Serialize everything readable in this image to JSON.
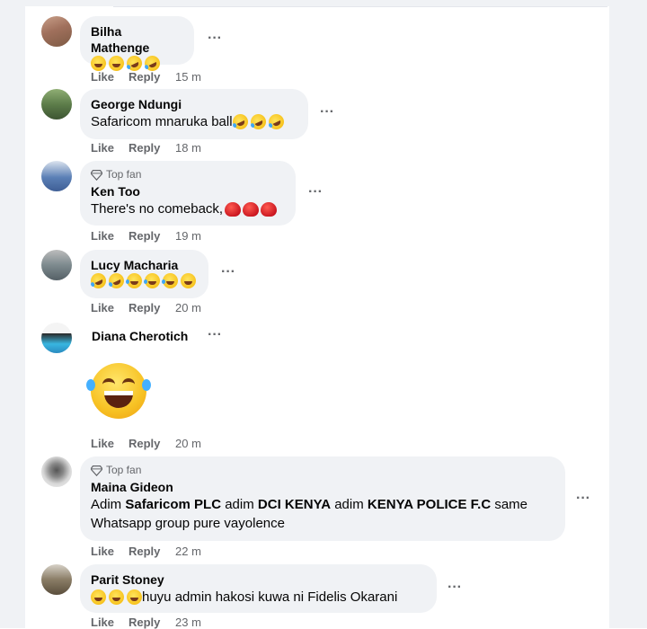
{
  "comments": [
    {
      "author": "Bilha Mathenge",
      "text": "",
      "emojis": 4,
      "top_fan": "",
      "like": "Like",
      "reply": "Reply",
      "time": "15 m"
    },
    {
      "author": "George Ndungi",
      "text": "Safaricom mnaruka ball",
      "emojis": 3,
      "top_fan": "",
      "like": "Like",
      "reply": "Reply",
      "time": "18 m"
    },
    {
      "author": "Ken Too",
      "text": "There's no comeback,",
      "emojis": 0,
      "gloves": 3,
      "top_fan": "Top fan",
      "like": "Like",
      "reply": "Reply",
      "time": "19 m"
    },
    {
      "author": "Lucy Macharia",
      "text": "",
      "emojis": 6,
      "top_fan": "",
      "like": "Like",
      "reply": "Reply",
      "time": "20 m"
    },
    {
      "author": "Diana Cherotich",
      "text": "",
      "big_emoji": "laughing-with-tears",
      "top_fan": "",
      "like": "Like",
      "reply": "Reply",
      "time": "20 m"
    },
    {
      "author": "Maina Gideon",
      "top_fan": "Top fan",
      "text_parts": [
        "Adim ",
        "Safaricom PLC",
        " adim ",
        "DCI KENYA",
        " adim ",
        "KENYA POLICE F.C",
        " same",
        "Whatsapp group pure vayolence"
      ],
      "like": "Like",
      "reply": "Reply",
      "time": "22 m"
    },
    {
      "author": "Parit Stoney",
      "text": " huyu admin hakosi kuwa ni Fidelis Okarani",
      "emojis": 3,
      "top_fan": "",
      "like": "Like",
      "reply": "Reply",
      "time": "23 m"
    }
  ],
  "more_icon": "three-dots-icon",
  "top_fan_icon": "diamond-badge-icon",
  "colors": {
    "bubble": "#f0f2f5",
    "meta": "#65676b",
    "text": "#050505"
  }
}
